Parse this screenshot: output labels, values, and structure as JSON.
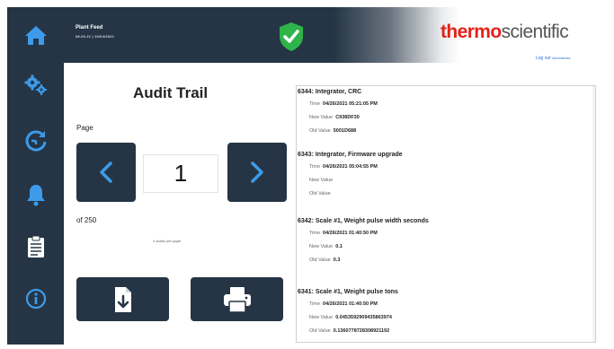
{
  "header": {
    "plant_name": "Plant Feed",
    "plant_sub": "08.06.21  |  10/04/2021",
    "brand_thermo": "thermo",
    "brand_scientific": "scientific",
    "logout_label": "Log out",
    "user_role": "Administrator"
  },
  "sidebar": {
    "items": [
      {
        "name": "home",
        "icon": "home-icon"
      },
      {
        "name": "settings",
        "icon": "gears-icon"
      },
      {
        "name": "calibration",
        "icon": "refresh-gauge-icon"
      },
      {
        "name": "alarms",
        "icon": "bell-icon"
      },
      {
        "name": "reports",
        "icon": "clipboard-icon"
      },
      {
        "name": "info",
        "icon": "info-icon"
      }
    ]
  },
  "audit": {
    "title": "Audit Trail",
    "page_label": "Page",
    "current_page": "1",
    "of_total": "of 250",
    "per_page_note": "4 audits per page",
    "export_icon": "download-file-icon",
    "print_icon": "printer-icon"
  },
  "labels": {
    "time": "Time",
    "new_value": "New Value",
    "old_value": "Old Value"
  },
  "entries": [
    {
      "title": "6344: Integrator, CRC",
      "time": "04/26/2021 05:21:05 PM",
      "new_value": "C938DF30",
      "old_value": "5001D688"
    },
    {
      "title": "6343: Integrator, Firmware upgrade",
      "time": "04/26/2021 05:04:55 PM",
      "new_value": "",
      "old_value": ""
    },
    {
      "title": "6342: Scale #1, Weight pulse width seconds",
      "time": "04/26/2021 01:40:50 PM",
      "new_value": "0.1",
      "old_value": "0.3"
    },
    {
      "title": "6341: Scale #1, Weight pulse tons",
      "time": "04/26/2021 01:40:50 PM",
      "new_value": "0.0453592909435863974",
      "old_value": "0.1360778728308921192"
    }
  ],
  "colors": {
    "navy": "#253545",
    "brand_red": "#e2231a",
    "status_green": "#2fb44a",
    "link_blue": "#2f6fd6"
  }
}
